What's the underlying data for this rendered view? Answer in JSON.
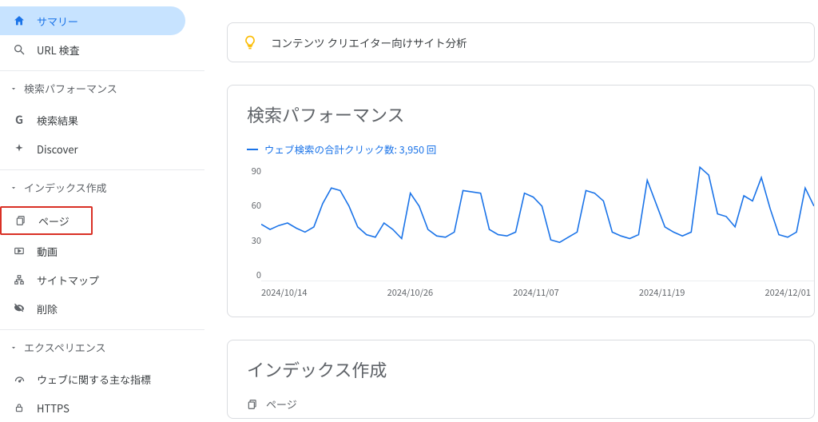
{
  "sidebar": {
    "top": [
      {
        "key": "summary",
        "label": "サマリー"
      },
      {
        "key": "url-inspect",
        "label": "URL 検査"
      }
    ],
    "sections": [
      {
        "title": "検索パフォーマンス",
        "items": [
          {
            "key": "search-results",
            "label": "検索結果"
          },
          {
            "key": "discover",
            "label": "Discover"
          }
        ]
      },
      {
        "title": "インデックス作成",
        "items": [
          {
            "key": "pages",
            "label": "ページ",
            "highlight": true
          },
          {
            "key": "video",
            "label": "動画"
          },
          {
            "key": "sitemaps",
            "label": "サイトマップ"
          },
          {
            "key": "removals",
            "label": "削除"
          }
        ]
      },
      {
        "title": "エクスペリエンス",
        "items": [
          {
            "key": "cwv",
            "label": "ウェブに関する主な指標"
          },
          {
            "key": "https",
            "label": "HTTPS"
          }
        ]
      }
    ]
  },
  "tip": {
    "text": "コンテンツ クリエイター向けサイト分析"
  },
  "perf": {
    "title": "検索パフォーマンス",
    "legend": "ウェブ検索の合計クリック数: 3,950 回"
  },
  "index_card": {
    "title": "インデックス作成",
    "subtitle": "ページ"
  },
  "chart_data": {
    "type": "line",
    "ylim": [
      0,
      90
    ],
    "yticks": [
      90,
      60,
      30,
      0
    ],
    "xticks": [
      "2024/10/14",
      "2024/10/26",
      "2024/11/07",
      "2024/11/19",
      "2024/12/01"
    ],
    "series": [
      {
        "name": "ウェブ検索の合計クリック数",
        "color": "#1a73e8",
        "values": [
          44,
          40,
          43,
          45,
          41,
          38,
          42,
          60,
          72,
          70,
          58,
          42,
          36,
          34,
          45,
          40,
          33,
          68,
          58,
          40,
          35,
          34,
          38,
          70,
          69,
          68,
          40,
          36,
          35,
          38,
          68,
          65,
          58,
          32,
          30,
          34,
          38,
          70,
          68,
          62,
          38,
          35,
          33,
          36,
          78,
          60,
          42,
          38,
          35,
          38,
          88,
          82,
          52,
          50,
          42,
          66,
          62,
          80,
          56,
          36,
          34,
          38,
          72,
          58
        ]
      }
    ]
  }
}
